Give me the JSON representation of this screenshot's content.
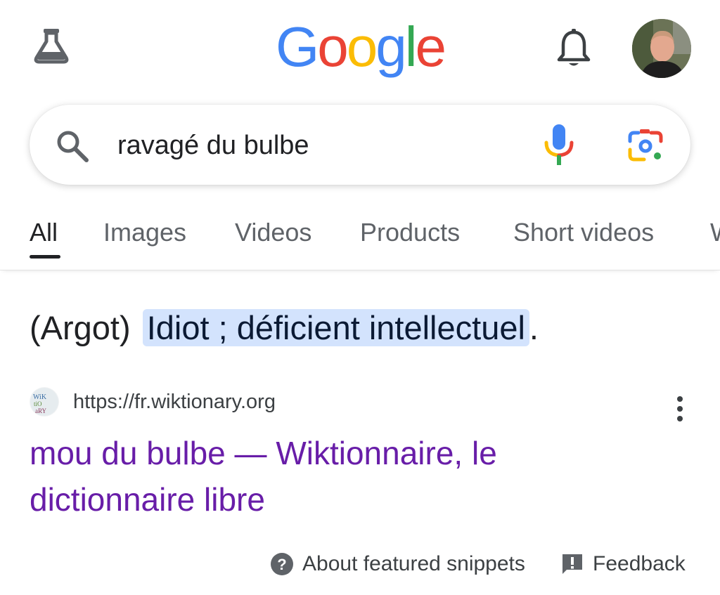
{
  "header": {
    "labs_icon": "flask-icon",
    "logo_letters": [
      {
        "ch": "G",
        "color": "#4285F4"
      },
      {
        "ch": "o",
        "color": "#EA4335"
      },
      {
        "ch": "o",
        "color": "#FBBC05"
      },
      {
        "ch": "g",
        "color": "#4285F4"
      },
      {
        "ch": "l",
        "color": "#34A853"
      },
      {
        "ch": "e",
        "color": "#EA4335"
      }
    ],
    "notifications_icon": "bell-icon",
    "avatar_icon": "profile-avatar"
  },
  "search": {
    "query": "ravagé du bulbe",
    "icons": [
      "search-icon",
      "mic-icon",
      "lens-icon"
    ]
  },
  "tabs": [
    {
      "label": "All",
      "active": true
    },
    {
      "label": "Images",
      "active": false
    },
    {
      "label": "Videos",
      "active": false
    },
    {
      "label": "Products",
      "active": false
    },
    {
      "label": "Short videos",
      "active": false
    },
    {
      "label": "W",
      "active": false
    }
  ],
  "featured_snippet": {
    "prefix": "(Argot)",
    "highlighted": "Idiot ; déficient intellectuel",
    "suffix": ".",
    "highlight_color": "#d3e3fd"
  },
  "source": {
    "url": "https://fr.wiktionary.org",
    "title": "mou du bulbe — Wiktionnaire, le dictionnaire libre",
    "title_color": "#681da8"
  },
  "footer": {
    "about_label": "About featured snippets",
    "feedback_label": "Feedback"
  }
}
